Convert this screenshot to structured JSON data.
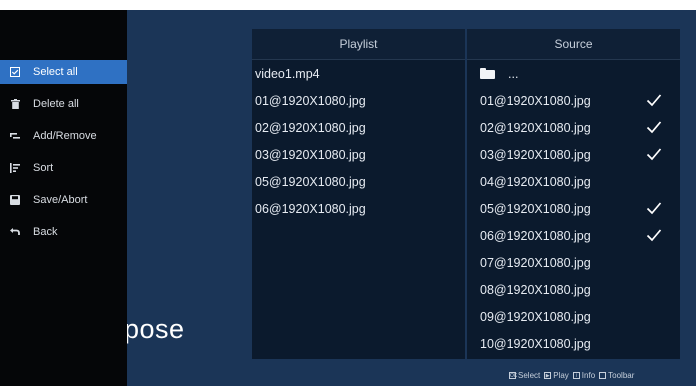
{
  "menu": {
    "items": [
      {
        "label": "Select all",
        "icon": "select-all-icon",
        "active": true
      },
      {
        "label": "Delete all",
        "icon": "trash-icon",
        "active": false
      },
      {
        "label": "Add/Remove",
        "icon": "add-remove-icon",
        "active": false
      },
      {
        "label": "Sort",
        "icon": "sort-icon",
        "active": false
      },
      {
        "label": "Save/Abort",
        "icon": "save-icon",
        "active": false
      },
      {
        "label": "Back",
        "icon": "back-icon",
        "active": false
      }
    ]
  },
  "background_word": "pose",
  "playlist": {
    "title": "Playlist",
    "items": [
      "video1.mp4",
      "01@1920X1080.jpg",
      "02@1920X1080.jpg",
      "03@1920X1080.jpg",
      "05@1920X1080.jpg",
      "06@1920X1080.jpg"
    ]
  },
  "source": {
    "title": "Source",
    "folder_label": "...",
    "items": [
      {
        "name": "01@1920X1080.jpg",
        "checked": true
      },
      {
        "name": "02@1920X1080.jpg",
        "checked": true
      },
      {
        "name": "03@1920X1080.jpg",
        "checked": true
      },
      {
        "name": "04@1920X1080.jpg",
        "checked": false
      },
      {
        "name": "05@1920X1080.jpg",
        "checked": true
      },
      {
        "name": "06@1920X1080.jpg",
        "checked": true
      },
      {
        "name": "07@1920X1080.jpg",
        "checked": false
      },
      {
        "name": "08@1920X1080.jpg",
        "checked": false
      },
      {
        "name": "09@1920X1080.jpg",
        "checked": false
      },
      {
        "name": "10@1920X1080.jpg",
        "checked": false
      }
    ]
  },
  "bottom_bar": {
    "select_key": "OK",
    "select_label": "Select",
    "play_label": "Play",
    "info_key": "i",
    "info_label": "Info",
    "toolbar_label": "Toolbar"
  },
  "colors": {
    "background": "#1b3557",
    "sidebar": "#050608",
    "active_item": "#2f71c3",
    "panel": "#0b1a2d"
  }
}
